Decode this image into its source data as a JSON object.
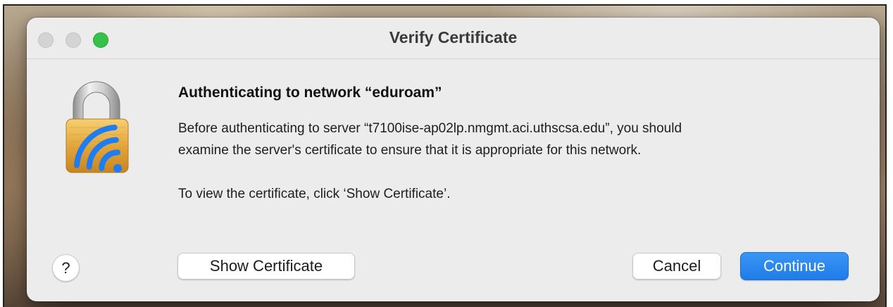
{
  "dialog": {
    "title": "Verify Certificate",
    "heading": "Authenticating to network “eduroam”",
    "paragraph1_line1": "Before authenticating to server “t7100ise-ap02lp.nmgmt.aci.uthscsa.edu”, you should",
    "paragraph1_line2": "examine the server's certificate to ensure that it is appropriate for this network.",
    "paragraph2": "To view the certificate, click ‘Show Certificate’.",
    "icon": "wifi-lock-icon"
  },
  "buttons": {
    "help_label": "?",
    "show_certificate_label": "Show Certificate",
    "cancel_label": "Cancel",
    "continue_label": "Continue"
  },
  "colors": {
    "accent": "#1f7ce8",
    "maximize": "#36c24a",
    "wifi_blue": "#1e7df0",
    "lock_gold": "#e2a83c"
  }
}
